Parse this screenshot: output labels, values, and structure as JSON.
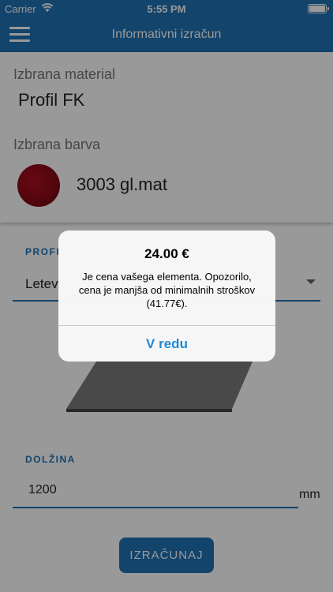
{
  "status": {
    "carrier": "Carrier",
    "time": "5:55 PM",
    "wifi_icon": "wifi-icon",
    "battery_icon": "battery-icon"
  },
  "nav": {
    "title": "Informativni izračun",
    "menu_icon": "hamburger-menu-icon"
  },
  "selection": {
    "material_label": "Izbrana material",
    "material_value": "Profil FK",
    "color_label": "Izbrana barva",
    "color_value": "3003 gl.mat",
    "color_hex": "#8a0a16"
  },
  "profile": {
    "label": "PROFI",
    "selected": "Letev"
  },
  "length": {
    "label": "DOLŽINA",
    "value": "1200",
    "unit": "mm"
  },
  "calculate_label": "IZRAČUNAJ",
  "alert": {
    "title": "24.00 €",
    "message": "Je cena vašega elementa. Opozorilo, cena je manjša od minimalnih stroškov (41.77€).",
    "button": "V redu"
  },
  "colors": {
    "brand": "#1e72b4",
    "alert_button": "#1e8ad6"
  }
}
